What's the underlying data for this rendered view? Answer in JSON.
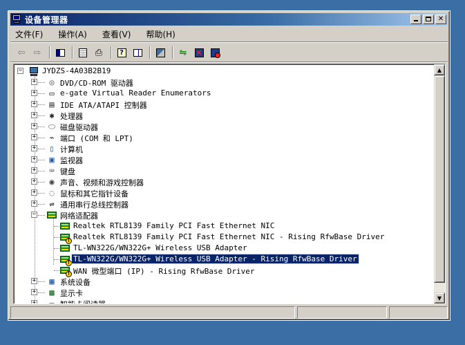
{
  "window": {
    "title": "设备管理器",
    "controls": [
      "minimize",
      "maximize",
      "close"
    ]
  },
  "menu": {
    "items": [
      {
        "label": "文件(F)"
      },
      {
        "label": "操作(A)"
      },
      {
        "label": "查看(V)"
      },
      {
        "label": "帮助(H)"
      }
    ]
  },
  "toolbar": {
    "buttons": [
      {
        "icon": "back-arrow-icon"
      },
      {
        "icon": "forward-arrow-icon"
      },
      {
        "icon": "show-hide-console-tree-icon"
      },
      {
        "icon": "properties-icon"
      },
      {
        "icon": "print-icon"
      },
      {
        "icon": "help-icon"
      },
      {
        "icon": "view-icon"
      },
      {
        "icon": "scan-hardware-icon"
      },
      {
        "icon": "update-driver-icon"
      },
      {
        "icon": "uninstall-icon"
      },
      {
        "icon": "disable-device-icon"
      }
    ]
  },
  "tree": {
    "root": {
      "label": "JYDZS-4A03B2B19",
      "expanded": true
    },
    "items": [
      {
        "label": "DVD/CD-ROM 驱动器",
        "icon": "dvd-icon",
        "expanded": false
      },
      {
        "label": "e-gate Virtual Reader Enumerators",
        "icon": "card-reader-icon",
        "expanded": false
      },
      {
        "label": "IDE ATA/ATAPI 控制器",
        "icon": "ide-controller-icon",
        "expanded": false
      },
      {
        "label": "处理器",
        "icon": "processor-icon",
        "expanded": false
      },
      {
        "label": "磁盘驱动器",
        "icon": "disk-drive-icon",
        "expanded": false
      },
      {
        "label": "端口 (COM 和 LPT)",
        "icon": "port-icon",
        "expanded": false
      },
      {
        "label": "计算机",
        "icon": "computer-icon",
        "expanded": false
      },
      {
        "label": "监视器",
        "icon": "monitor-icon",
        "expanded": false
      },
      {
        "label": "键盘",
        "icon": "keyboard-icon",
        "expanded": false
      },
      {
        "label": "声音、视频和游戏控制器",
        "icon": "sound-icon",
        "expanded": false
      },
      {
        "label": "鼠标和其它指针设备",
        "icon": "mouse-icon",
        "expanded": false
      },
      {
        "label": "通用串行总线控制器",
        "icon": "usb-icon",
        "expanded": false
      },
      {
        "label": "网络适配器",
        "icon": "network-adapter-icon",
        "expanded": true,
        "children": [
          {
            "label": "Realtek RTL8139 Family PCI Fast Ethernet NIC",
            "warning": false
          },
          {
            "label": "Realtek RTL8139 Family PCI Fast Ethernet NIC - Rising RfwBase Driver",
            "warning": true
          },
          {
            "label": "TL-WN322G/WN322G+ Wireless USB Adapter",
            "warning": false
          },
          {
            "label": "TL-WN322G/WN322G+ Wireless USB Adapter - Rising RfwBase Driver",
            "warning": true,
            "selected": true
          },
          {
            "label": "WAN 微型端口 (IP) - Rising RfwBase Driver",
            "warning": true
          }
        ]
      },
      {
        "label": "系统设备",
        "icon": "system-device-icon",
        "expanded": false
      },
      {
        "label": "显示卡",
        "icon": "display-adapter-icon",
        "expanded": false
      },
      {
        "label": "智能卡阅读器",
        "icon": "smart-card-reader-icon",
        "expanded": false
      }
    ]
  }
}
